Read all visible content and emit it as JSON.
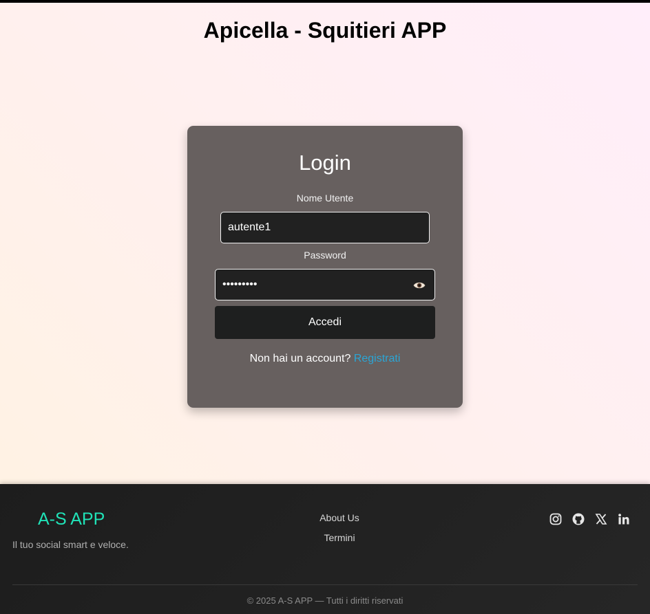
{
  "header": {
    "title": "Apicella - Squitieri APP"
  },
  "login": {
    "title": "Login",
    "username_label": "Nome Utente",
    "username_value": "autente1",
    "password_label": "Password",
    "password_value": "•••••••••",
    "show_password_icon": "eye-icon",
    "submit_label": "Accedi",
    "signup_prompt": "Non hai un account?",
    "signup_link": "Registrati"
  },
  "footer": {
    "brand": "A-S APP",
    "tagline": "Il tuo social smart e veloce.",
    "links": [
      "About Us",
      "Termini"
    ],
    "social_icons": [
      "instagram-icon",
      "github-icon",
      "x-icon",
      "linkedin-icon"
    ],
    "copyright": "© 2025 A-S APP — Tutti i diritti riservati"
  },
  "colors": {
    "card_bg": "#67605f",
    "input_bg": "#212121",
    "button_bg": "#1e1f1f",
    "link": "#2aa6d6",
    "brand": "#20e3b8",
    "footer_bg": "#222222"
  }
}
